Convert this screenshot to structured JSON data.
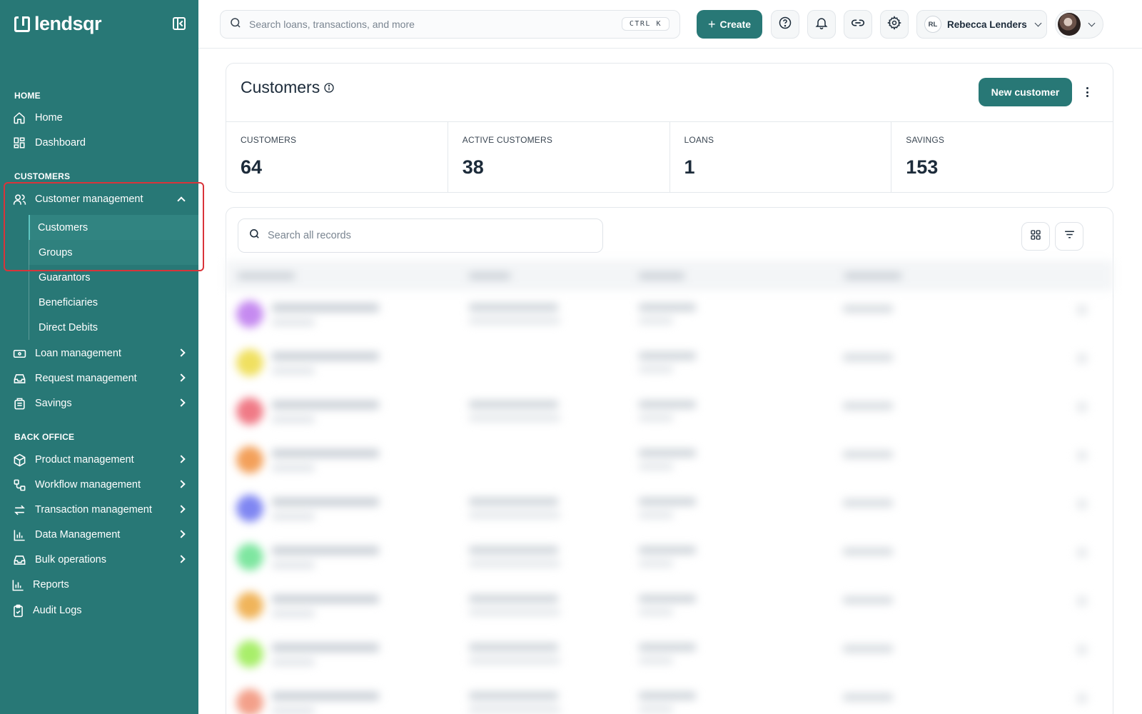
{
  "brand": {
    "name": "lendsqr"
  },
  "sidebar": {
    "sections": {
      "home": "HOME",
      "customers": "CUSTOMERS",
      "back_office": "BACK OFFICE"
    },
    "home_items": [
      {
        "label": "Home",
        "icon": "house-icon"
      },
      {
        "label": "Dashboard",
        "icon": "grid-icon"
      }
    ],
    "customer_management": {
      "label": "Customer management",
      "icon": "users-icon",
      "expanded": true,
      "children": [
        "Customers",
        "Groups",
        "Guarantors",
        "Beneficiaries",
        "Direct Debits"
      ],
      "active_child": "Customers"
    },
    "other_items": [
      {
        "label": "Loan management",
        "icon": "banknote-icon"
      },
      {
        "label": "Request management",
        "icon": "inbox-icon"
      },
      {
        "label": "Savings",
        "icon": "piggybank-icon"
      }
    ],
    "back_office_items": [
      {
        "label": "Product management",
        "icon": "box-icon"
      },
      {
        "label": "Workflow management",
        "icon": "workflow-icon"
      },
      {
        "label": "Transaction management",
        "icon": "arrows-icon"
      },
      {
        "label": "Data Management",
        "icon": "bar-chart-icon"
      },
      {
        "label": "Bulk operations",
        "icon": "inbox-icon"
      },
      {
        "label": "Reports",
        "icon": "bar-chart-icon"
      },
      {
        "label": "Audit Logs",
        "icon": "clipboard-icon"
      }
    ]
  },
  "topbar": {
    "search_placeholder": "Search loans, transactions, and more",
    "shortcut": "CTRL K",
    "create_label": "Create",
    "user": {
      "initials": "RL",
      "name": "Rebecca Lenders"
    }
  },
  "page": {
    "title": "Customers",
    "new_button": "New customer",
    "stats": [
      {
        "label": "CUSTOMERS",
        "value": "64"
      },
      {
        "label": "ACTIVE CUSTOMERS",
        "value": "38"
      },
      {
        "label": "LOANS",
        "value": "1"
      },
      {
        "label": "SAVINGS",
        "value": "153"
      }
    ],
    "records_search_placeholder": "Search all records"
  },
  "colors": {
    "brand": "#287876",
    "highlight": "#d9343a",
    "avatar_colors": [
      "#c58af0",
      "#f0e060",
      "#f07a86",
      "#f3a05a",
      "#7f86f2",
      "#7ee6a0",
      "#f0b45a",
      "#a8ee6a",
      "#f3a08a"
    ]
  }
}
